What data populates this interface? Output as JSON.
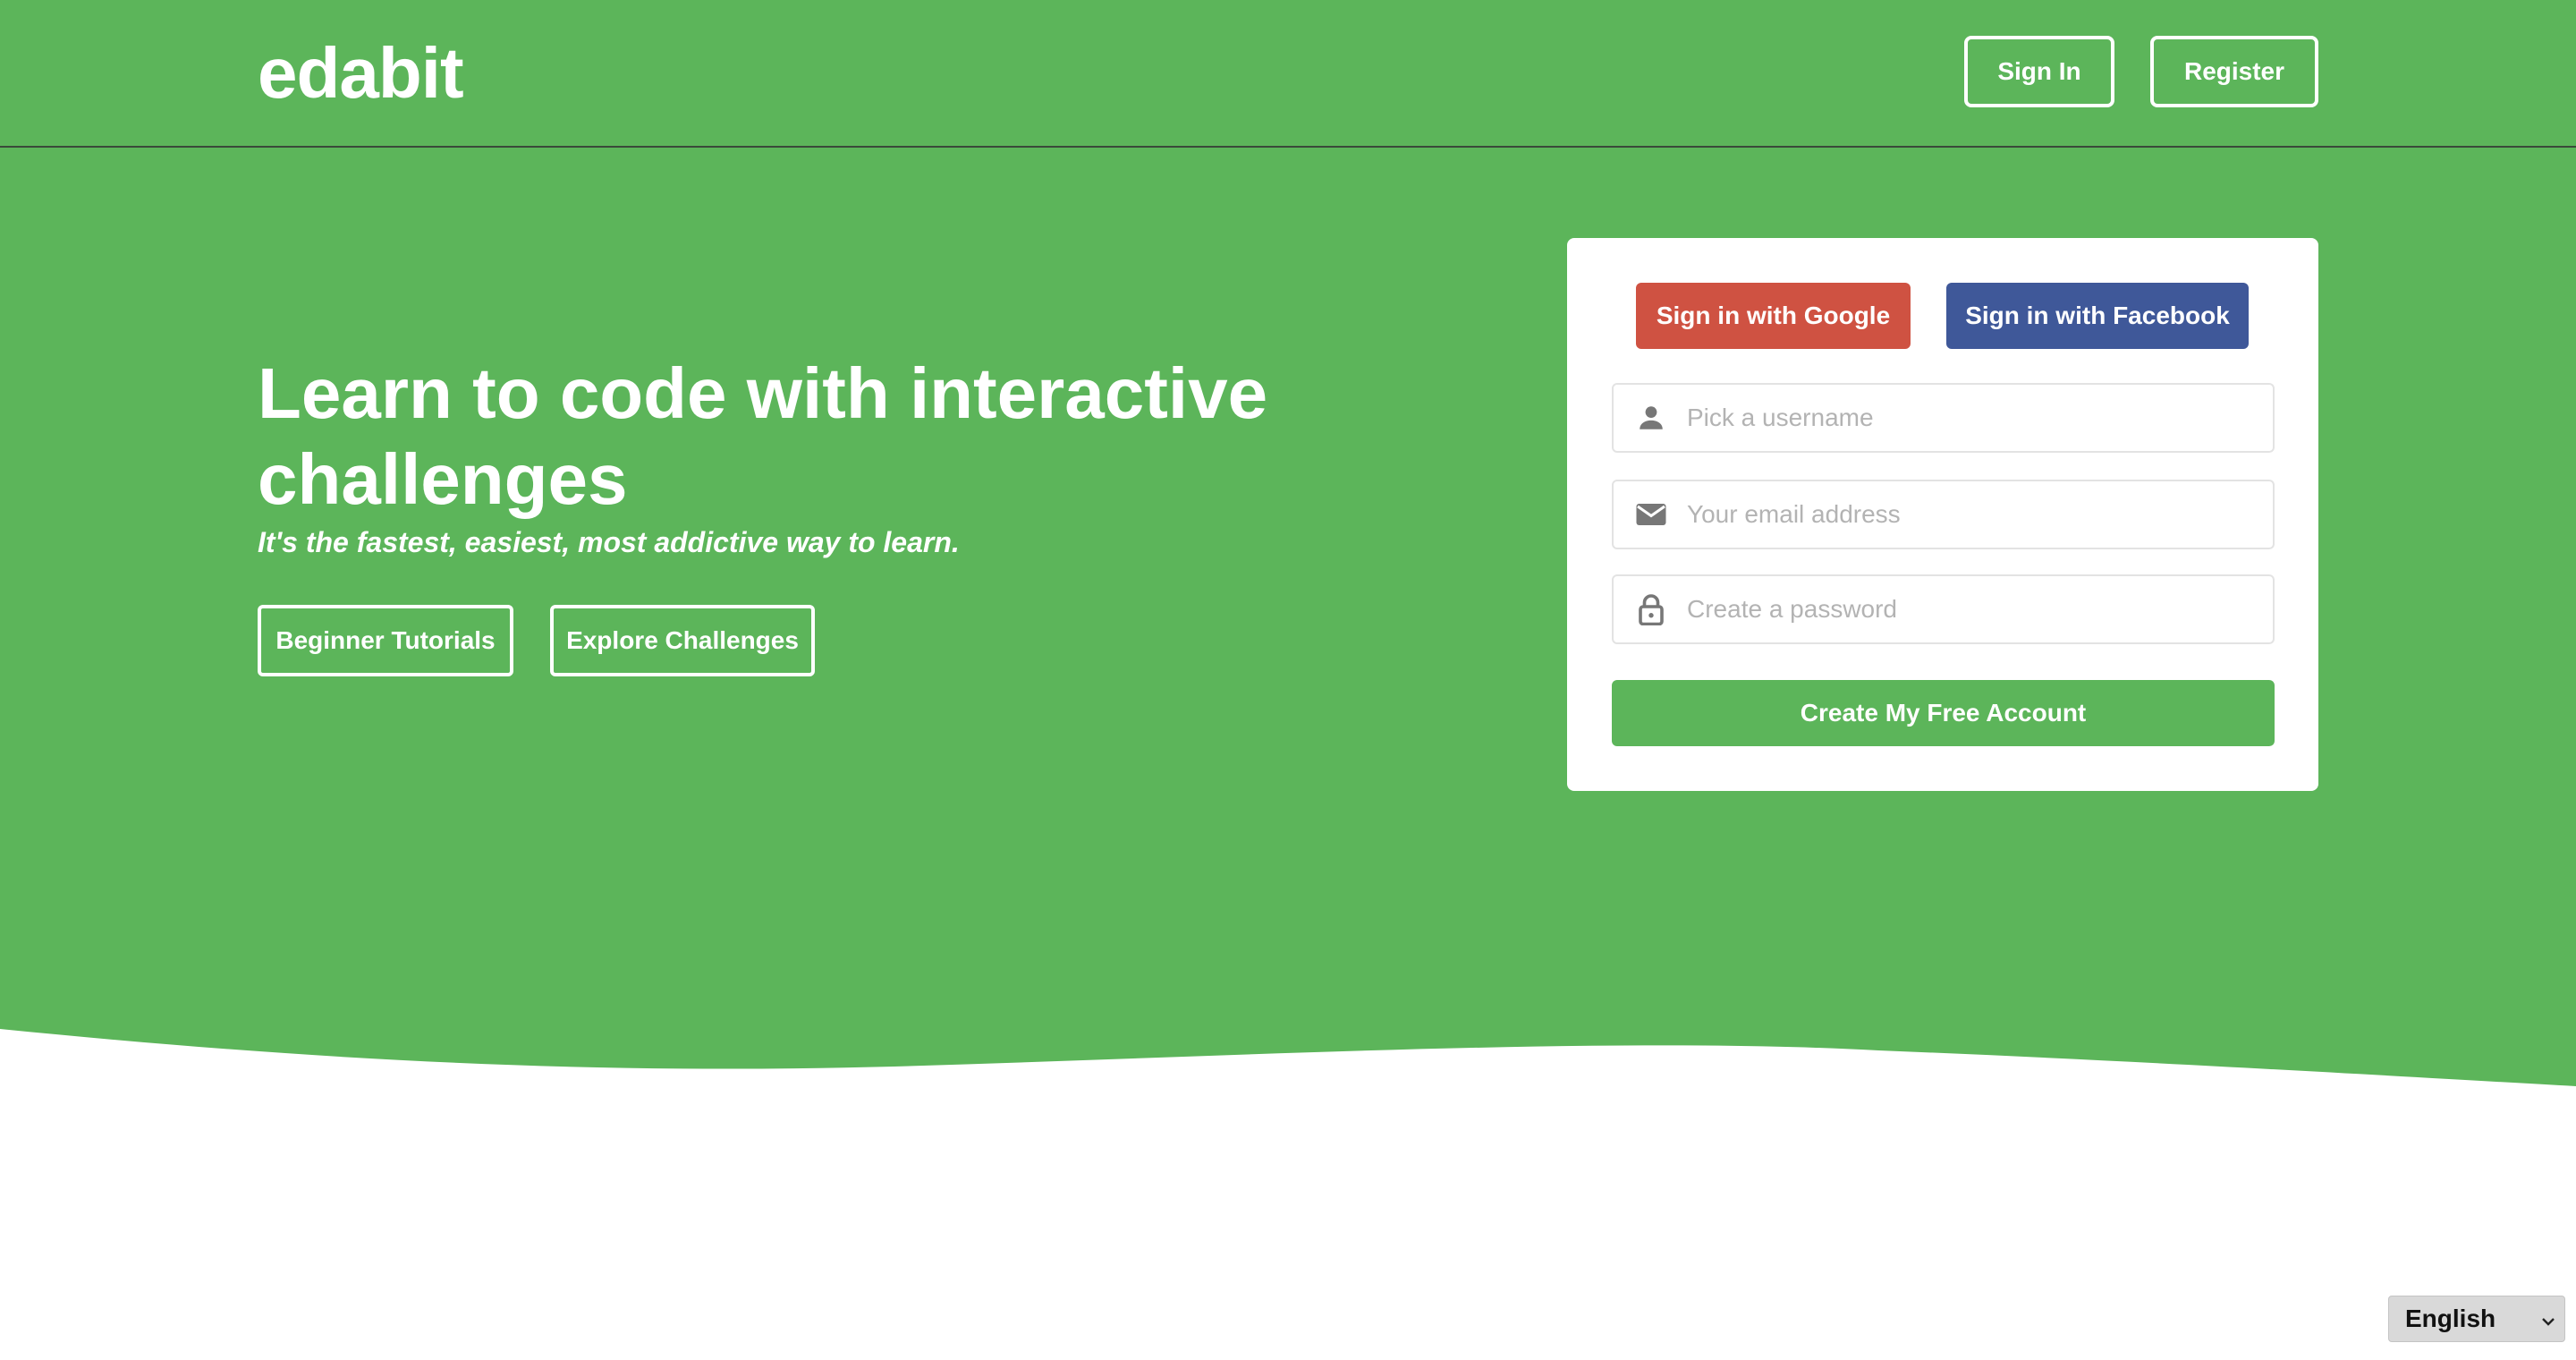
{
  "header": {
    "logo": "edabit",
    "sign_in": "Sign In",
    "register": "Register"
  },
  "hero": {
    "headline": "Learn to code with interactive challenges",
    "tagline": "It's the fastest, easiest, most addictive way to learn.",
    "cta_tutorials": "Beginner Tutorials",
    "cta_challenges": "Explore Challenges"
  },
  "signup": {
    "google": "Sign in with Google",
    "facebook": "Sign in with Facebook",
    "username_placeholder": "Pick a username",
    "email_placeholder": "Your email address",
    "password_placeholder": "Create a password",
    "submit": "Create My Free Account"
  },
  "language": {
    "selected": "English"
  },
  "colors": {
    "brand_green": "#5cb55a",
    "google_red": "#cf5242",
    "facebook_blue": "#3f5899"
  },
  "icons": [
    "user-icon",
    "email-icon",
    "lock-icon",
    "chevron-down-icon"
  ]
}
